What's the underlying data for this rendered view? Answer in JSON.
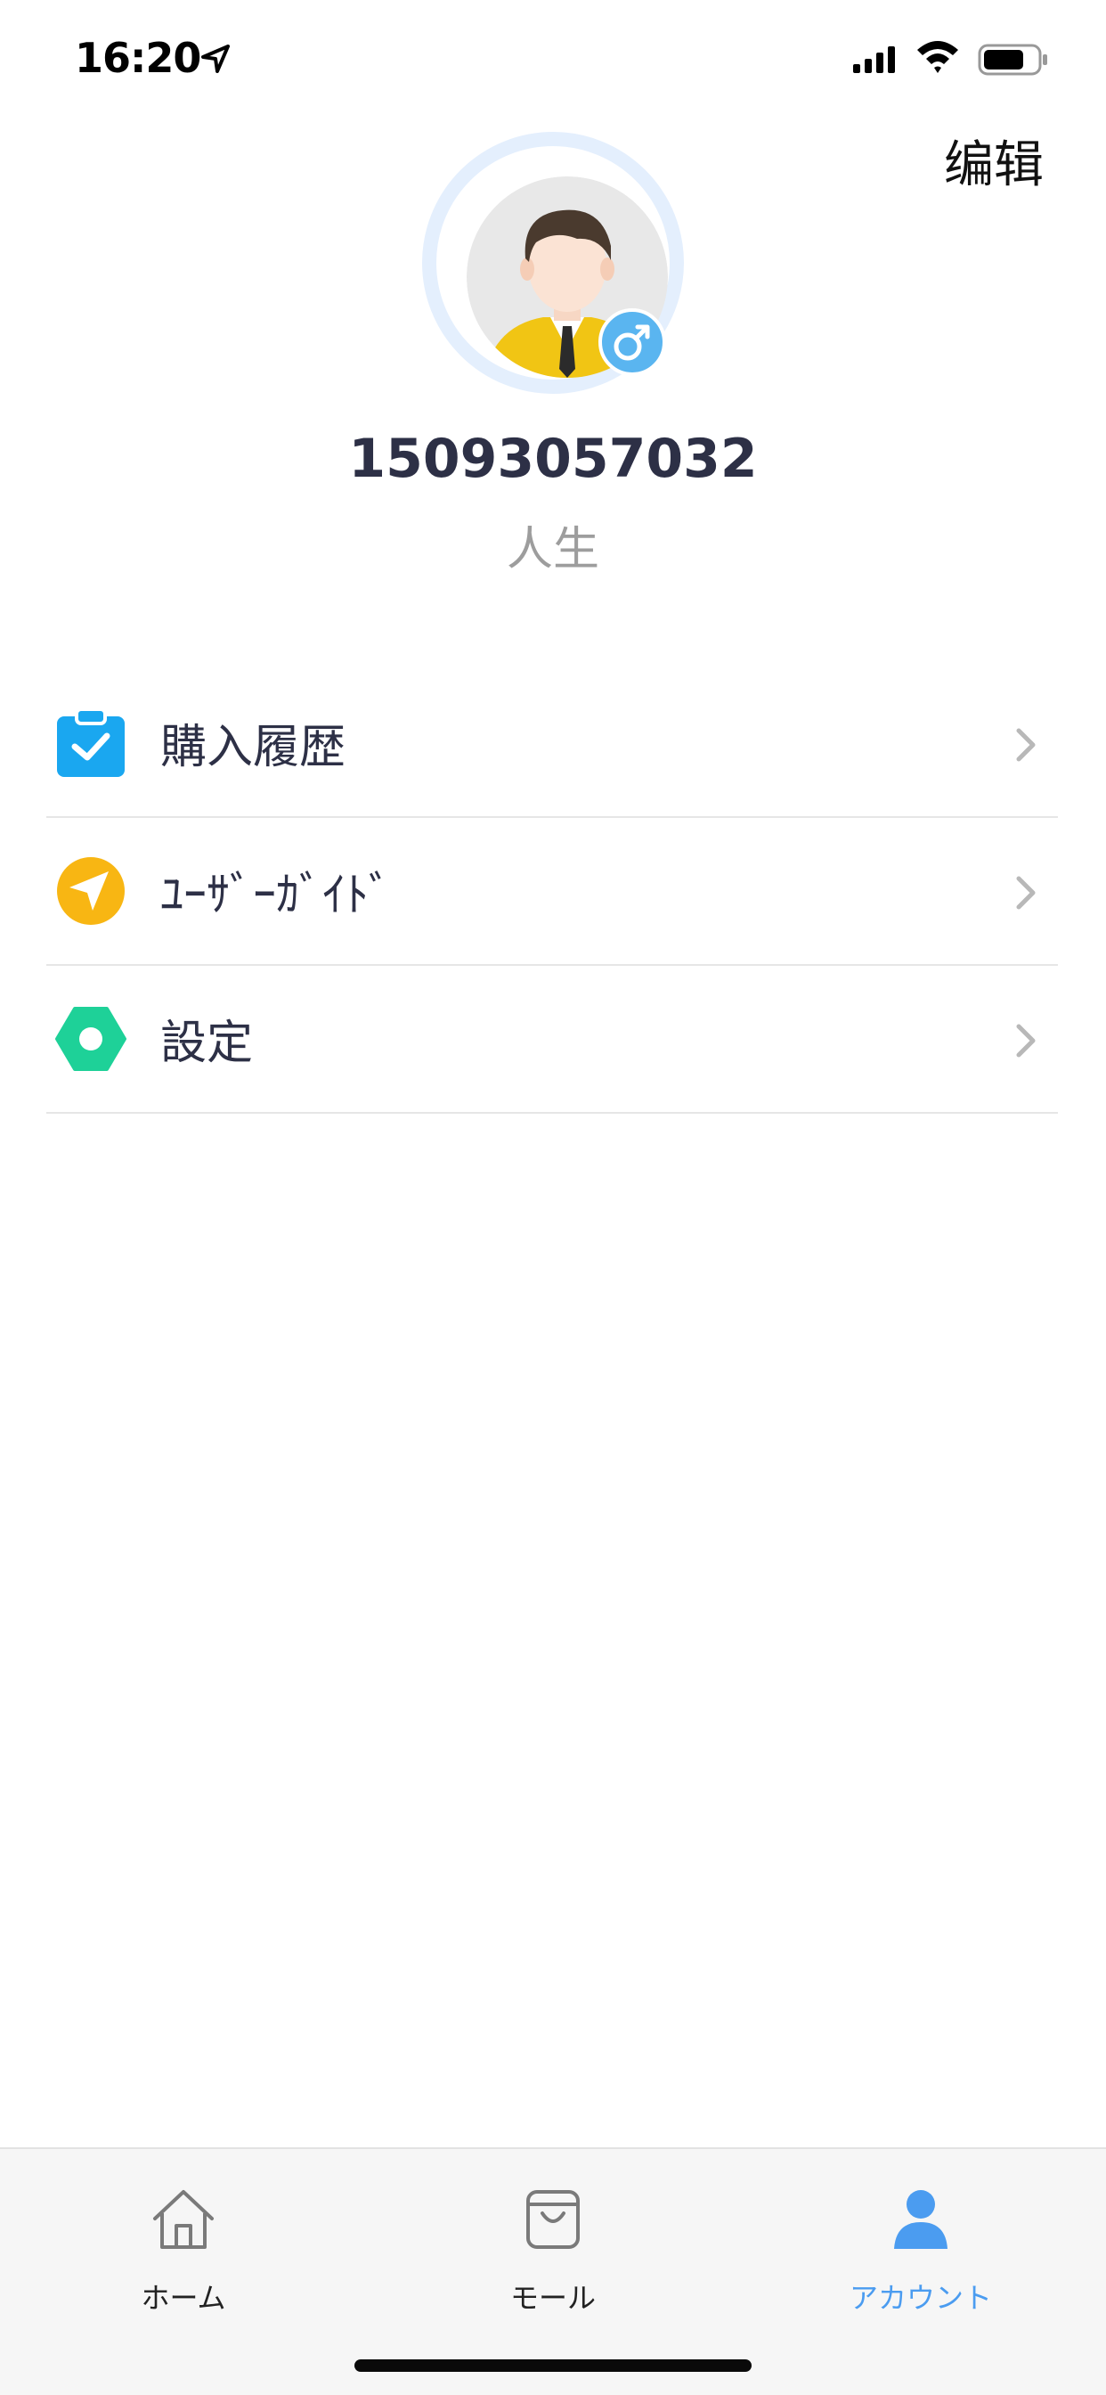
{
  "status_bar": {
    "time": "16:20",
    "icons": [
      "location-arrow-icon",
      "cellular-signal-icon",
      "wifi-icon",
      "battery-icon"
    ]
  },
  "header": {
    "edit_label": "编辑"
  },
  "profile": {
    "avatar": "avatar-male-businessman",
    "gender_icon": "male-symbol-icon",
    "gender_symbol": "♂",
    "phone_number": "15093057032",
    "subtitle": "人生"
  },
  "menu": {
    "items": [
      {
        "label": "購入履歴",
        "icon": "clipboard-check-icon",
        "color": "#1aa7f0"
      },
      {
        "label": "ﾕｰｻﾞｰｶﾞｲﾄﾞ",
        "icon": "navigation-arrow-icon",
        "color": "#f8b613"
      },
      {
        "label": "設定",
        "icon": "hexagon-settings-icon",
        "color": "#1ed198"
      }
    ]
  },
  "tab_bar": {
    "tabs": [
      {
        "label": "ホーム",
        "icon": "home-icon",
        "active": false
      },
      {
        "label": "モール",
        "icon": "shopping-bag-icon",
        "active": false
      },
      {
        "label": "アカウント",
        "icon": "person-icon",
        "active": true
      }
    ],
    "active_color": "#4b9cf0"
  }
}
